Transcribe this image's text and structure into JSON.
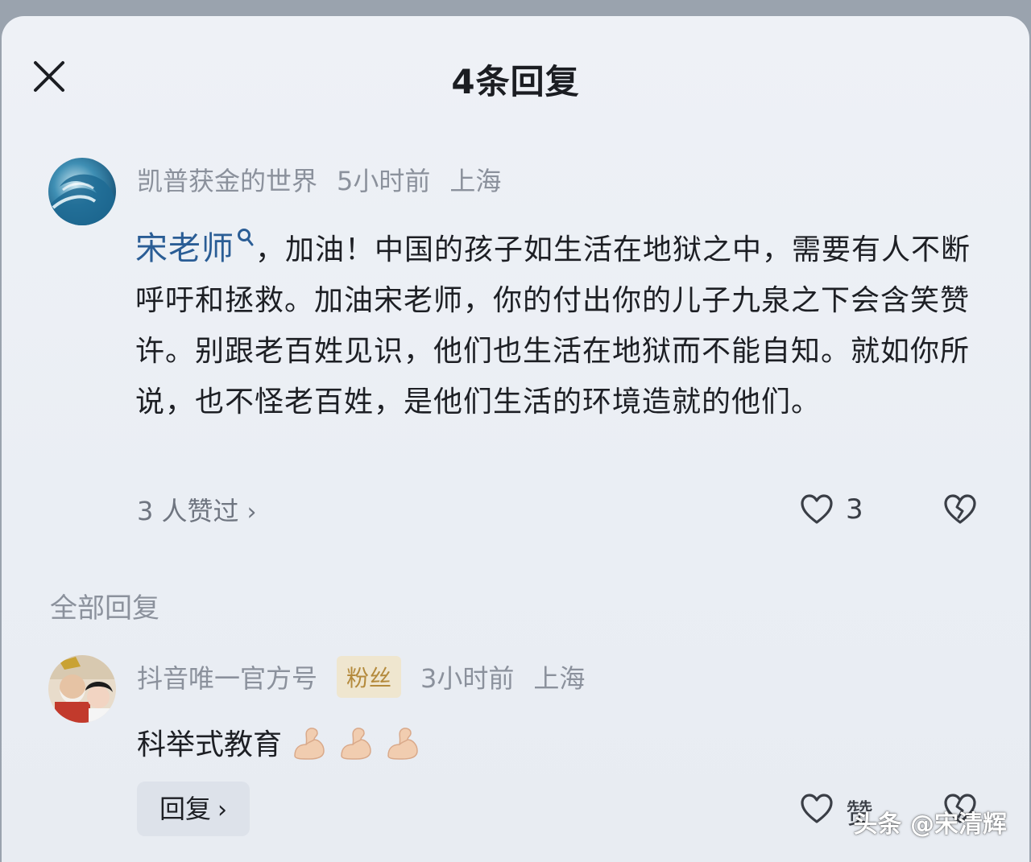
{
  "header": {
    "title": "4条回复",
    "close_icon": "close-icon"
  },
  "comment": {
    "author": "凯普获金的世界",
    "time": "5小时前",
    "location": "上海",
    "mention": "宋老师",
    "text": "，加油！中国的孩子如生活在地狱之中，需要有人不断呼吁和拯救。加油宋老师，你的付出你的儿子九泉之下会含笑赞许。别跟老百姓见识，他们也生活在地狱而不能自知。就如你所说，也不怪老百姓，是他们生活的环境造就的他们。",
    "likes_link": "3 人赞过",
    "like_count": "3"
  },
  "section": {
    "label": "全部回复"
  },
  "reply": {
    "author": "抖音唯一官方号",
    "badge": "粉丝",
    "time": "3小时前",
    "location": "上海",
    "text": "科举式教育",
    "emoji": [
      "flexed-biceps",
      "flexed-biceps",
      "flexed-biceps"
    ],
    "reply_button": "回复",
    "like_label": "赞"
  },
  "watermark": "头条 @宋清辉",
  "colors": {
    "mention": "#2a5d95",
    "badge_bg": "#efe6cf",
    "badge_text": "#b48a3c",
    "meta": "#8b919c"
  }
}
